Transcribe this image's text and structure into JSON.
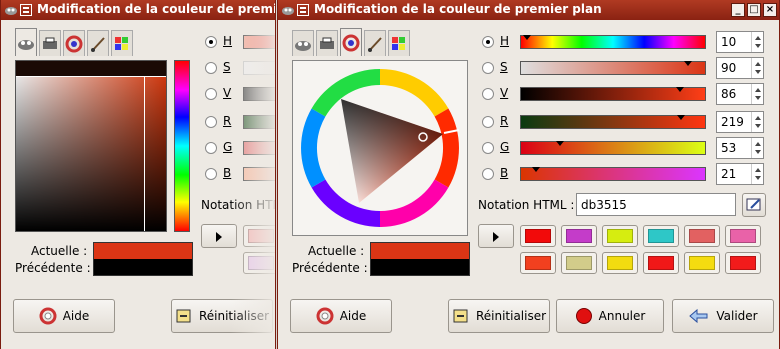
{
  "dialog_left": {
    "title": "Modification de la couleur de premier plan",
    "channels": [
      {
        "key": "H",
        "selected": true
      },
      {
        "key": "S",
        "selected": false
      },
      {
        "key": "V",
        "selected": false
      },
      {
        "key": "R",
        "selected": false
      },
      {
        "key": "G",
        "selected": false
      },
      {
        "key": "B",
        "selected": false
      }
    ],
    "html_notation_label": "Notation HTML",
    "current_label": "Actuelle :",
    "previous_label": "Précédente :",
    "current_color": "#db3515",
    "previous_color": "#000000",
    "help_label": "Aide",
    "reset_label": "Réinitialiser"
  },
  "dialog_right": {
    "title": "Modification de la couleur de premier plan",
    "channels": [
      {
        "key": "H",
        "value": "10",
        "selected": true
      },
      {
        "key": "S",
        "value": "90",
        "selected": false
      },
      {
        "key": "V",
        "value": "86",
        "selected": false
      },
      {
        "key": "R",
        "value": "219",
        "selected": false
      },
      {
        "key": "G",
        "value": "53",
        "selected": false
      },
      {
        "key": "B",
        "value": "21",
        "selected": false
      }
    ],
    "html_notation_label": "Notation HTML :",
    "html_value": "db3515",
    "current_label": "Actuelle :",
    "previous_label": "Précédente :",
    "current_color": "#db3515",
    "previous_color": "#000000",
    "history_colors": [
      "#f20a0a",
      "#c43cc9",
      "#d6ed10",
      "#2ec7c7",
      "#e26161",
      "#e962a8",
      "#f2401f",
      "#d2cc8a",
      "#f2dc10",
      "#f01818",
      "#f4dc10",
      "#f21b1b"
    ],
    "help_label": "Aide",
    "reset_label": "Réinitialiser",
    "cancel_label": "Annuler",
    "ok_label": "Valider"
  },
  "icons": {
    "app": "gimp-wilber-icon",
    "window_menu": "window-menu-icon",
    "minimize": "minimize-icon",
    "maximize": "maximize-icon",
    "close": "close-icon",
    "eyedropper": "eyedropper-icon"
  }
}
